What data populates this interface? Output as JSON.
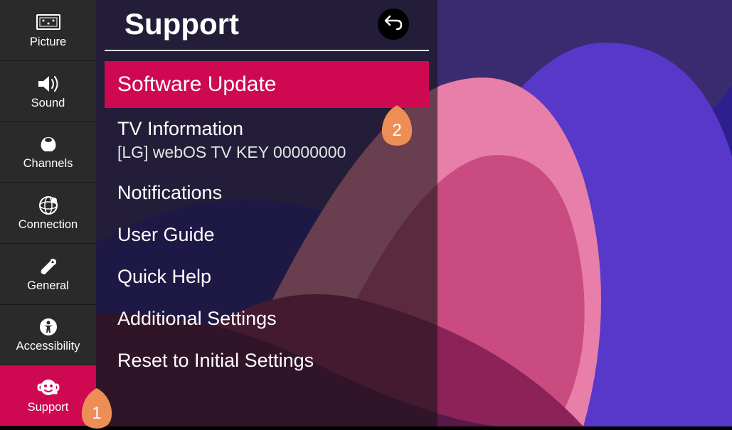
{
  "sidebar": {
    "items": [
      {
        "label": "Picture"
      },
      {
        "label": "Sound"
      },
      {
        "label": "Channels"
      },
      {
        "label": "Connection"
      },
      {
        "label": "General"
      },
      {
        "label": "Accessibility"
      },
      {
        "label": "Support"
      }
    ]
  },
  "panel": {
    "title": "Support",
    "menu": [
      {
        "label": "Software Update",
        "highlighted": true
      },
      {
        "label": "TV Information",
        "sub": "[LG] webOS TV KEY 00000000"
      },
      {
        "label": "Notifications"
      },
      {
        "label": "User Guide"
      },
      {
        "label": "Quick Help"
      },
      {
        "label": "Additional Settings"
      },
      {
        "label": "Reset to Initial Settings"
      }
    ]
  },
  "callouts": {
    "one": "1",
    "two": "2"
  }
}
